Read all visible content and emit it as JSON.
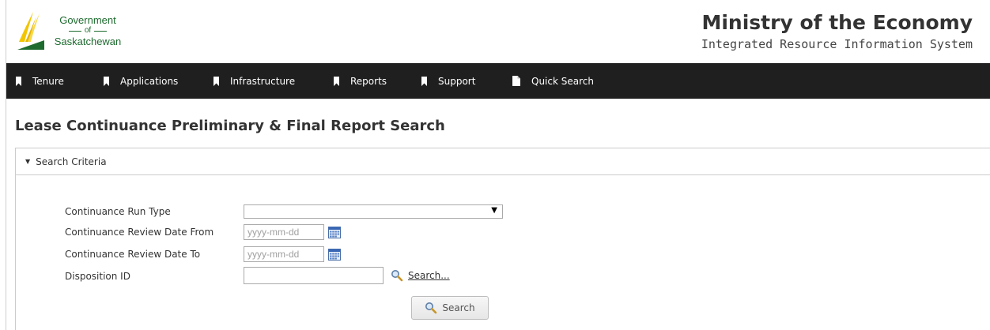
{
  "header": {
    "logo": {
      "line1": "Government",
      "line2": "of",
      "line3": "Saskatchewan"
    },
    "title": "Ministry of the Economy",
    "subtitle": "Integrated Resource Information System"
  },
  "nav": {
    "items": [
      {
        "label": "Tenure",
        "icon": "bookmark-icon"
      },
      {
        "label": "Applications",
        "icon": "bookmark-icon"
      },
      {
        "label": "Infrastructure",
        "icon": "bookmark-icon"
      },
      {
        "label": "Reports",
        "icon": "bookmark-icon"
      },
      {
        "label": "Support",
        "icon": "bookmark-icon"
      },
      {
        "label": "Quick Search",
        "icon": "document-icon"
      }
    ]
  },
  "page": {
    "title": "Lease Continuance Preliminary & Final Report Search"
  },
  "panel": {
    "header": "Search Criteria",
    "caret": "▼",
    "fields": {
      "run_type": {
        "label": "Continuance Run Type",
        "value": ""
      },
      "date_from": {
        "label": "Continuance Review Date From",
        "placeholder": "yyyy-mm-dd",
        "value": ""
      },
      "date_to": {
        "label": "Continuance Review Date To",
        "placeholder": "yyyy-mm-dd",
        "value": ""
      },
      "disposition": {
        "label": "Disposition ID",
        "value": "",
        "lookup_label": "Search..."
      }
    },
    "search_button": "Search"
  },
  "colors": {
    "nav_bg": "#1f1f1f",
    "logo_green": "#1e6b2f",
    "logo_yellow": "#f2c500"
  }
}
